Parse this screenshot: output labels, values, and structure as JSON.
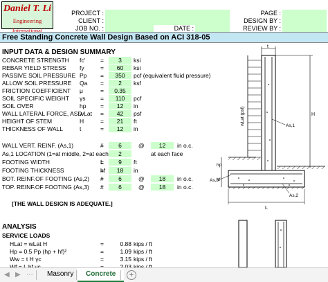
{
  "header": {
    "logo_name": "Daniel T. Li",
    "logo_sub": "Engineering International",
    "project_label": "PROJECT :",
    "client_label": "CLIENT :",
    "job_no_label": "JOB NO. :",
    "date_label": "DATE :",
    "page_label": "PAGE :",
    "design_by_label": "DESIGN BY :",
    "review_by_label": "REVIEW BY :"
  },
  "title": "Free Standing Concrete Wall Design Based on ACI 318-05",
  "input_section_title": "INPUT DATA & DESIGN SUMMARY",
  "inputs": [
    {
      "label": "CONCRETE STRENGTH",
      "sym": "fc'",
      "eq": "=",
      "val": "3",
      "unit": "ksi"
    },
    {
      "label": "REBAR YIELD STRESS",
      "sym": "fy",
      "eq": "=",
      "val": "60",
      "unit": "ksi"
    },
    {
      "label": "PASSIVE SOIL PRESSURE",
      "sym": "Pp",
      "eq": "=",
      "val": "350",
      "unit": "pcf (equivalent fluid pressure)"
    },
    {
      "label": "ALLOW SOIL PRESSURE",
      "sym": "Qa",
      "eq": "=",
      "val": "2",
      "unit": "ksf"
    },
    {
      "label": "FRICTION COEFFICIENT",
      "sym": "μ",
      "eq": "=",
      "val": "0.35",
      "unit": ""
    },
    {
      "label": "SOIL SPECIFIC WEIGHT",
      "sym": "γs",
      "eq": "=",
      "val": "110",
      "unit": "pcf"
    },
    {
      "label": "SOIL OVER",
      "sym": "hp",
      "eq": "=",
      "val": "12",
      "unit": "in"
    },
    {
      "label": "WALL LATERAL FORCE, ASD",
      "sym": "wLat",
      "eq": "=",
      "val": "42",
      "unit": "psf"
    },
    {
      "label": "HEIGHT OF STEM",
      "sym": "H",
      "eq": "=",
      "val": "21",
      "unit": "ft"
    },
    {
      "label": "THICKNESS OF WALL",
      "sym": "t",
      "eq": "=",
      "val": "12",
      "unit": "in"
    }
  ],
  "inputs2": [
    {
      "label": "WALL VERT. REINF. (As,1)",
      "sym": "#",
      "val": "6",
      "at": "@",
      "val2": "12",
      "unit2": "in o.c."
    },
    {
      "label": "As,1 LOCATION (1=at middle, 2=at each face)",
      "sym": "",
      "val": "2",
      "at": "",
      "val2": "",
      "unit2": "at each face"
    },
    {
      "label": "FOOTING WIDTH",
      "sym": "L",
      "eq": "=",
      "val": "9",
      "unit": "ft"
    },
    {
      "label": "FOOTING THICKNESS",
      "sym": "hf",
      "eq": "=",
      "val": "18",
      "unit": "in"
    },
    {
      "label": "BOT. REINF.OF FOOTING (As,2)",
      "sym": "#",
      "val": "6",
      "at": "@",
      "val2": "18",
      "unit2": "in o.c."
    },
    {
      "label": "TOP. REINF.OF FOOTING (As,3)",
      "sym": "#",
      "val": "6",
      "at": "@",
      "val2": "18",
      "unit2": "in o.c."
    }
  ],
  "adequate": "[THE WALL DESIGN IS ADEQUATE.]",
  "analysis_title": "ANALYSIS",
  "service_loads_title": "SERVICE LOADS",
  "loads": [
    {
      "formula": "HLat = wLat H",
      "eq": "=",
      "val": "0.88",
      "unit": "kips / ft"
    },
    {
      "formula": "Hp = 0.5 Pp (hp + hf)²",
      "eq": "=",
      "val": "1.09",
      "unit": "kips / ft"
    },
    {
      "formula": "Ww = t H γc",
      "eq": "=",
      "val": "3.15",
      "unit": "kips / ft"
    },
    {
      "formula": "Wf = L hf γc",
      "eq": "=",
      "val": "2.03",
      "unit": "kips / ft"
    }
  ],
  "diagram": {
    "t_label": "t",
    "wlat_label": "wLat (psf)",
    "as1_label": "As,1",
    "h_label": "H",
    "hp_label": "hp",
    "hf_label": "hf",
    "as3_label": "As,3",
    "as2_label": "As,2",
    "l_label": "L"
  },
  "tabs": [
    {
      "label": "Masonry",
      "active": false
    },
    {
      "label": "Concrete",
      "active": true
    }
  ],
  "add_sheet": "+",
  "colors": {
    "input_green": "#ccffcc",
    "title_blue": "#c3e6f3",
    "logo_red": "#c00000",
    "tab_green": "#1e7b3b"
  }
}
